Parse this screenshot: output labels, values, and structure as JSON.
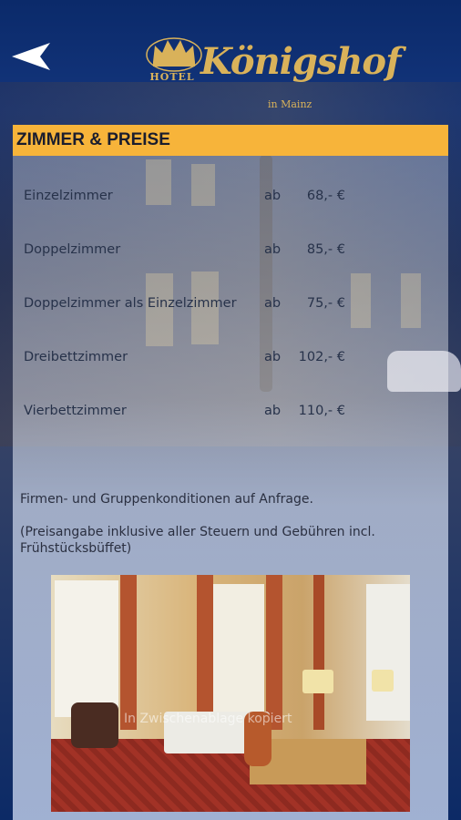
{
  "header": {
    "back_icon": "back-arrow-icon",
    "logo": {
      "hotel": "HOTEL",
      "name": "Königshof",
      "sub": "in Mainz"
    }
  },
  "section": {
    "title": "ZIMMER & PREISE"
  },
  "prices": [
    {
      "room": "Einzelzimmer",
      "ab": "ab",
      "price": "68,- €"
    },
    {
      "room": "Doppelzimmer",
      "ab": "ab",
      "price": "85,- €"
    },
    {
      "room": "Doppelzimmer als Einzelzimmer",
      "ab": "ab",
      "price": "75,- €"
    },
    {
      "room": "Dreibettzimmer",
      "ab": "ab",
      "price": "102,- €"
    },
    {
      "room": "Vierbettzimmer",
      "ab": "ab",
      "price": "110,- €"
    }
  ],
  "notes": {
    "conditions": "Firmen- und Gruppenkonditionen auf Anfrage.",
    "tax": "(Preisangabe inklusive aller Steuern und Gebühren incl. Frühstücksbüffet)"
  },
  "photo": {
    "watermark": "In Zwischenablage kopiert"
  },
  "colors": {
    "accent": "#f7b43a",
    "background": "#0d2c6e",
    "logo_gold": "#d9b25a"
  }
}
